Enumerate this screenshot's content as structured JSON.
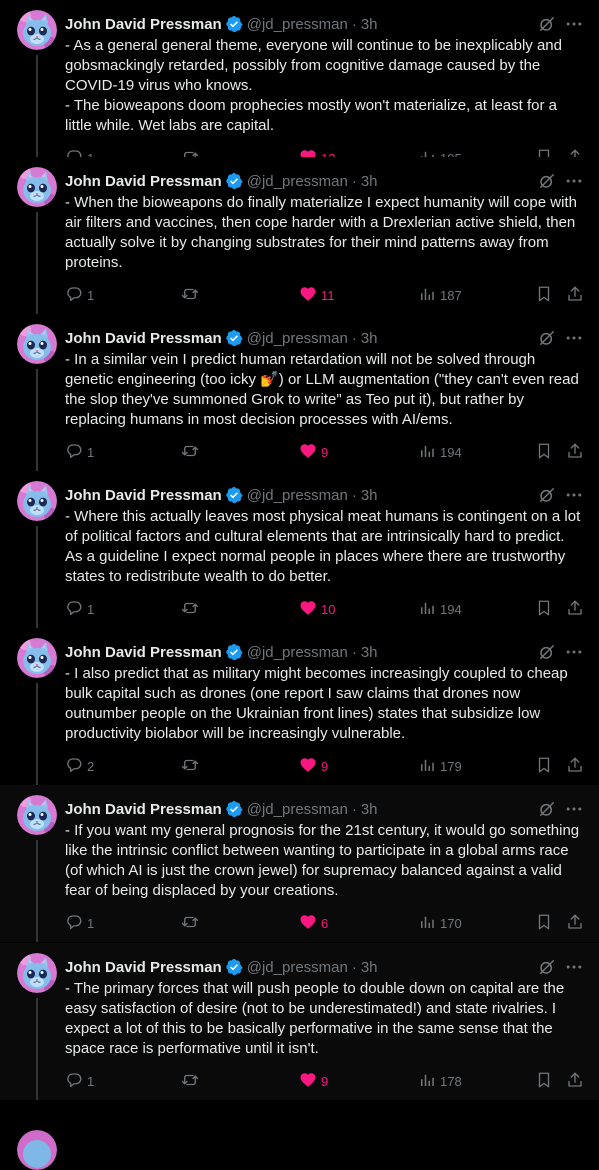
{
  "author": {
    "name": "John David Pressman",
    "handle": "@jd_pressman",
    "separator": "·"
  },
  "colors": {
    "background": "#000000",
    "text": "#e7e9ea",
    "muted": "#71767b",
    "like": "#f91880",
    "verified": "#1d9bf0"
  },
  "icons": {
    "reply": "reply-icon",
    "repost": "repost-icon",
    "like": "heart-icon",
    "views": "views-icon",
    "bookmark": "bookmark-icon",
    "share": "share-icon",
    "grok": "grok-icon",
    "more": "more-icon"
  },
  "tweets": [
    {
      "time": "3h",
      "text": "- As a general general theme, everyone will continue to be inexplicably and gobsmackingly retarded, possibly from cognitive damage caused by the COVID-19 virus who knows.\n- The bioweapons doom prophecies mostly won't materialize, at least for a little while. Wet labs are capital.",
      "replies": "1",
      "reposts": "",
      "likes": "13",
      "views": "195"
    },
    {
      "time": "3h",
      "text": "- When the bioweapons do finally materialize I expect humanity will cope with air filters and vaccines, then cope harder with a Drexlerian active shield, then actually solve it by changing substrates for their mind patterns away from proteins.",
      "replies": "1",
      "reposts": "",
      "likes": "11",
      "views": "187"
    },
    {
      "time": "3h",
      "text": "- In a similar vein I predict human retardation will not be solved through genetic engineering (too icky 💅) or LLM augmentation (\"they can't even read the slop they've summoned Grok to write\" as Teo put it), but rather by replacing humans in most decision processes with AI/ems.",
      "replies": "1",
      "reposts": "",
      "likes": "9",
      "views": "194"
    },
    {
      "time": "3h",
      "text": "- Where this actually leaves most physical meat humans is contingent on a lot of political factors and cultural elements that are intrinsically hard to predict. As a guideline I expect normal people in places where there are trustworthy states to redistribute wealth to do better.",
      "replies": "1",
      "reposts": "",
      "likes": "10",
      "views": "194"
    },
    {
      "time": "3h",
      "text": "- I also predict that as military might becomes increasingly coupled to cheap bulk capital such as drones (one report I saw claims that drones now outnumber people on the Ukrainian front lines) states that subsidize low productivity biolabor will be increasingly vulnerable.",
      "replies": "2",
      "reposts": "",
      "likes": "9",
      "views": "179"
    },
    {
      "time": "3h",
      "text": "- If you want my general prognosis for the 21st century, it would go something like the intrinsic conflict between wanting to participate in a global arms race (of which AI is just the crown jewel) for supremacy balanced against a valid fear of being displaced by your creations.",
      "replies": "1",
      "reposts": "",
      "likes": "6",
      "views": "170"
    },
    {
      "time": "3h",
      "text": "- The primary forces that will push people to double down on capital are the easy satisfaction of desire (not to be underestimated!) and state rivalries. I expect a lot of this to be basically performative in the same sense that the space race is performative until it isn't.",
      "replies": "1",
      "reposts": "",
      "likes": "9",
      "views": "178"
    }
  ]
}
